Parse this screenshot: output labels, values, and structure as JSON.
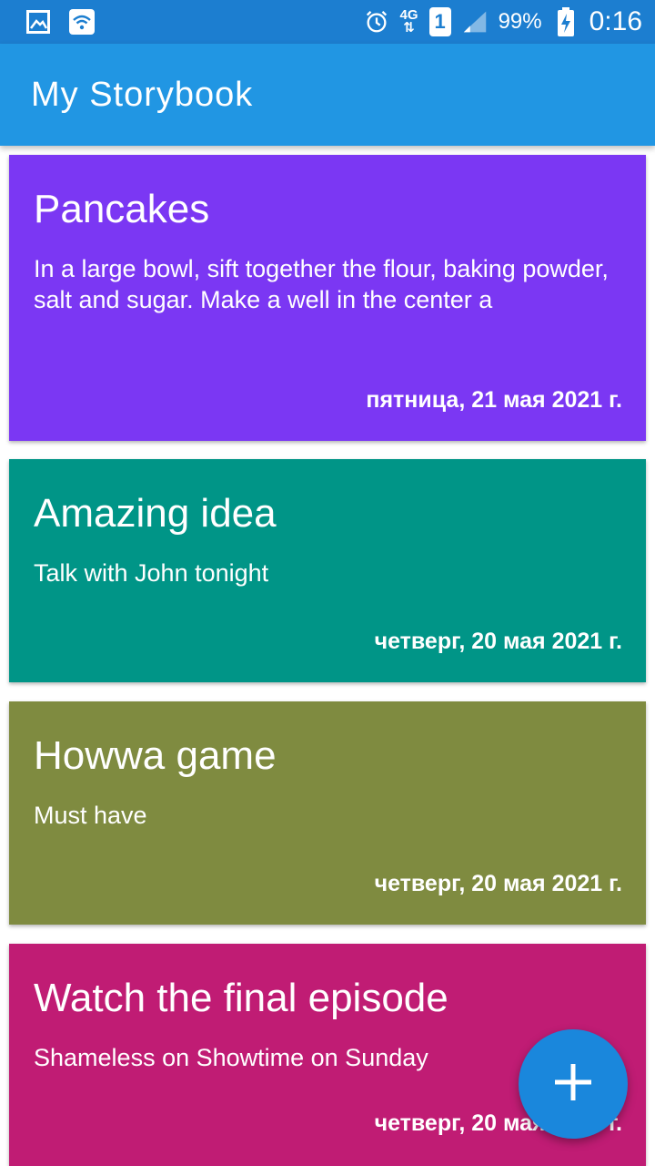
{
  "status_bar": {
    "network": "4G",
    "sim": "1",
    "battery": "99%",
    "time": "0:16",
    "icons": [
      "gallery-icon",
      "wifi-icon",
      "alarm-icon",
      "signal-icon",
      "battery-charging-icon"
    ]
  },
  "app": {
    "title": "My Storybook"
  },
  "colors": {
    "status_bar": "#1c7ed0",
    "app_bar": "#2196e3",
    "fab": "#1a87dc"
  },
  "notes": [
    {
      "title": "Pancakes",
      "body": "In a large bowl, sift together the flour, baking powder, salt and sugar. Make a well in the center a",
      "date": "пятница, 21 мая 2021 г.",
      "color": "#7b37f3"
    },
    {
      "title": "Amazing idea",
      "body": "Talk with John tonight",
      "date": "четверг, 20 мая 2021 г.",
      "color": "#009587"
    },
    {
      "title": "Howwa game",
      "body": "Must have",
      "date": "четверг, 20 мая 2021 г.",
      "color": "#7f8b40"
    },
    {
      "title": "Watch the final episode",
      "body": "Shameless on Showtime on Sunday",
      "date": "четверг, 20 мая 2021 г.",
      "color": "#c01c74"
    }
  ],
  "fab": {
    "icon": "plus-icon",
    "label": "+"
  }
}
